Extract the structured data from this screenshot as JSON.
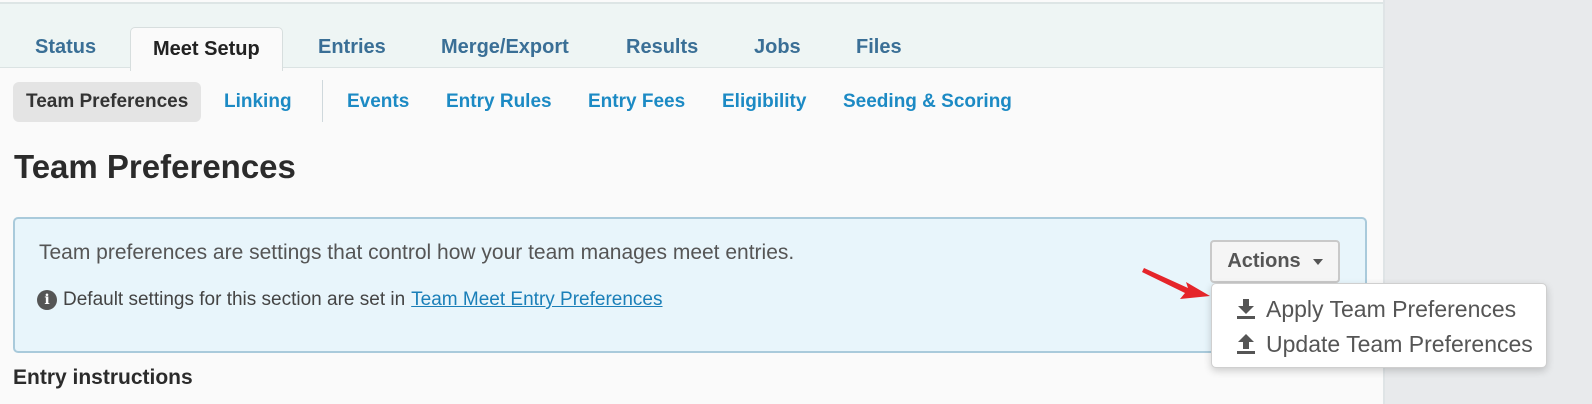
{
  "tabs": {
    "status": "Status",
    "meet_setup": "Meet Setup",
    "entries": "Entries",
    "merge_export": "Merge/Export",
    "results": "Results",
    "jobs": "Jobs",
    "files": "Files"
  },
  "subnav": {
    "team_preferences": "Team Preferences",
    "linking": "Linking",
    "events": "Events",
    "entry_rules": "Entry Rules",
    "entry_fees": "Entry Fees",
    "eligibility": "Eligibility",
    "seeding_scoring": "Seeding & Scoring"
  },
  "page": {
    "title": "Team Preferences",
    "info_text": "Team preferences are settings that control how your team manages meet entries.",
    "default_text": "Default settings for this section are set in",
    "default_link": "Team Meet Entry Preferences",
    "section_heading": "Entry instructions"
  },
  "actions": {
    "label": "Actions",
    "items": [
      {
        "label": "Apply Team Preferences",
        "icon": "download-icon"
      },
      {
        "label": "Update Team Preferences",
        "icon": "upload-icon"
      }
    ]
  },
  "colors": {
    "accent": "#1c8ac4",
    "tab_text": "#3a6f96",
    "info_bg": "#e8f5fb",
    "arrow": "#e5252a"
  }
}
